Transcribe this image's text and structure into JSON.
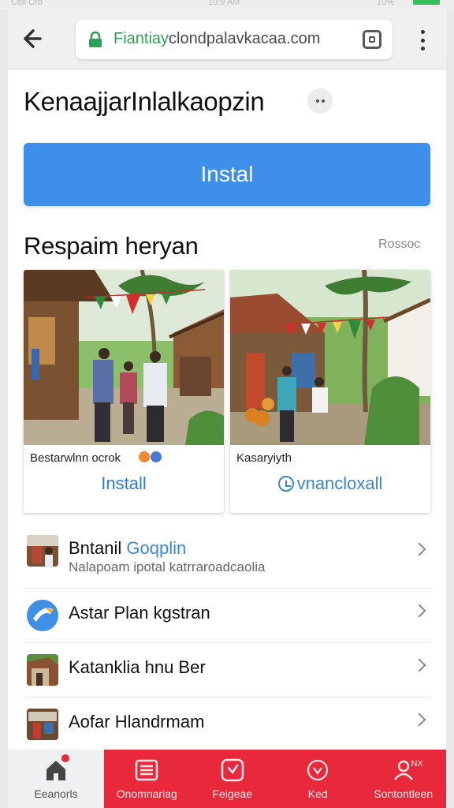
{
  "status_bar": {
    "carrier": "Cell Cro",
    "time": "10:9 AM",
    "battery": "10%"
  },
  "browser": {
    "url_host": "Fiantiay",
    "url_rest": "clondpalavkacaa.com"
  },
  "page": {
    "title": "KenaajjarInlalkaopzin",
    "install_label": "Instal"
  },
  "section": {
    "title": "Respaim heryan",
    "link_label": "Rossoc"
  },
  "cards": [
    {
      "name": "Bestarwlnn ocrok",
      "action": "Install",
      "badge_colors": [
        "#f08a30",
        "#4a78d0"
      ]
    },
    {
      "name": "Kasaryiyth",
      "action": "vnancloxall"
    }
  ],
  "list": [
    {
      "title": "Bntanil",
      "title_accent": "Goqplin",
      "subtitle": "Nalapoam ipotal katrraroadcaolia"
    },
    {
      "title": "Astar Plan kgstran"
    },
    {
      "title": "Katanklia hnu Ber"
    },
    {
      "title": "Aofar Hlandrmam"
    }
  ],
  "bottom_nav": [
    {
      "label": "Eeanorls",
      "icon": "home-icon"
    },
    {
      "label": "Onomnariag",
      "icon": "list-icon"
    },
    {
      "label": "Feigeae",
      "icon": "clock-icon"
    },
    {
      "label": "Ked",
      "icon": "shield-icon"
    },
    {
      "label": "Sontontleen",
      "icon": "person-icon",
      "extra": "NX"
    }
  ],
  "colors": {
    "primary_blue": "#3d8fe9",
    "nav_red": "#e8283b",
    "lock_green": "#2c9e58"
  }
}
